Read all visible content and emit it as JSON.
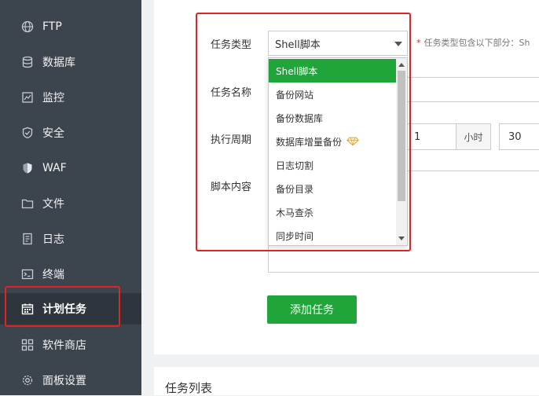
{
  "sidebar": {
    "items": [
      {
        "label": "FTP",
        "icon": "globe-icon"
      },
      {
        "label": "数据库",
        "icon": "database-icon"
      },
      {
        "label": "监控",
        "icon": "monitor-icon"
      },
      {
        "label": "安全",
        "icon": "shield-icon"
      },
      {
        "label": "WAF",
        "icon": "waf-shield-icon"
      },
      {
        "label": "文件",
        "icon": "folder-icon"
      },
      {
        "label": "日志",
        "icon": "log-icon"
      },
      {
        "label": "终端",
        "icon": "terminal-icon"
      },
      {
        "label": "计划任务",
        "icon": "calendar-icon",
        "active": true
      },
      {
        "label": "软件商店",
        "icon": "grid-icon"
      },
      {
        "label": "面板设置",
        "icon": "gear-icon"
      }
    ]
  },
  "form": {
    "task_type_label": "任务类型",
    "task_type_value": "Shell脚本",
    "task_type_hint_star": "*",
    "task_type_hint": "任务类型包含以下部分：Sh",
    "task_name_label": "任务名称",
    "cycle_label": "执行周期",
    "cycle_hour_value": "1",
    "cycle_hour_unit": "小时",
    "cycle_minute_value": "30",
    "script_label": "脚本内容",
    "add_button": "添加任务"
  },
  "dropdown": {
    "options": [
      "Shell脚本",
      "备份网站",
      "备份数据库",
      "数据库增量备份",
      "日志切割",
      "备份目录",
      "木马查杀",
      "同步时间"
    ],
    "selected_index": 0,
    "pro_option_index": 3,
    "accent_color": "#20a53a",
    "scroll_thumb_fraction": 0.75
  },
  "task_list": {
    "title": "任务列表"
  }
}
